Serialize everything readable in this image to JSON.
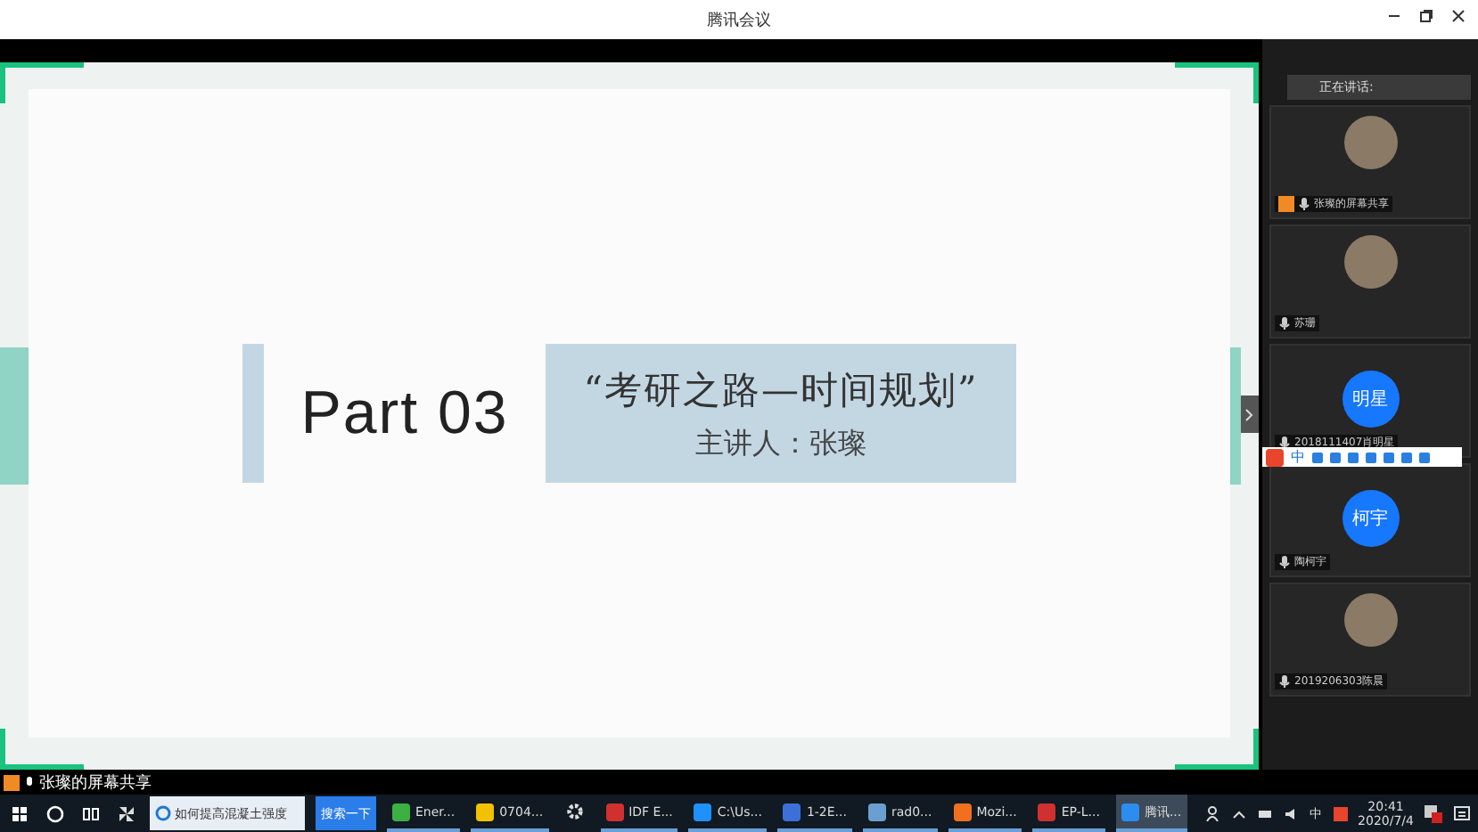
{
  "window": {
    "title": "腾讯会议"
  },
  "slide": {
    "heading": "Part 03",
    "title": "“考研之路—时间规划”",
    "subtitle": "主讲人：张璨"
  },
  "sidebar": {
    "speaking_label": "正在讲话:",
    "participants": [
      {
        "kind": "photo",
        "name": "张璨的屏幕共享",
        "host": true
      },
      {
        "kind": "photo",
        "name": "苏珊",
        "host": false
      },
      {
        "kind": "initials",
        "initials": "明星",
        "name": "2018111407肖明星",
        "host": false
      },
      {
        "kind": "initials",
        "initials": "柯宇",
        "name": "陶柯宇",
        "host": false
      },
      {
        "kind": "photo",
        "name": "2019206303陈晨",
        "host": false
      }
    ]
  },
  "ime_toolbar": {
    "mode": "中"
  },
  "share_status": "张璨的屏幕共享",
  "taskbar": {
    "search": {
      "value": "如何提高混凝土强度",
      "button": "搜索一下"
    },
    "apps": [
      {
        "label": "Ener...",
        "color": "#3cb043",
        "selected": false
      },
      {
        "label": "0704...",
        "color": "#f2c200",
        "selected": false
      },
      {
        "kind": "gear",
        "selected": false
      },
      {
        "label": "IDF E...",
        "color": "#d03030",
        "selected": false
      },
      {
        "label": "C:\\Us...",
        "color": "#1e90ff",
        "selected": false
      },
      {
        "label": "1-2E...",
        "color": "#3c6fd8",
        "selected": false
      },
      {
        "label": "rad0...",
        "color": "#6a9fd0",
        "selected": false
      },
      {
        "label": "Mozi...",
        "color": "#f07020",
        "selected": false
      },
      {
        "label": "EP-L...",
        "color": "#d03030",
        "selected": false
      },
      {
        "label": "腾讯...",
        "color": "#2d8cf0",
        "selected": true
      }
    ],
    "ime": "中",
    "time": "20:41",
    "date": "2020/7/4"
  }
}
